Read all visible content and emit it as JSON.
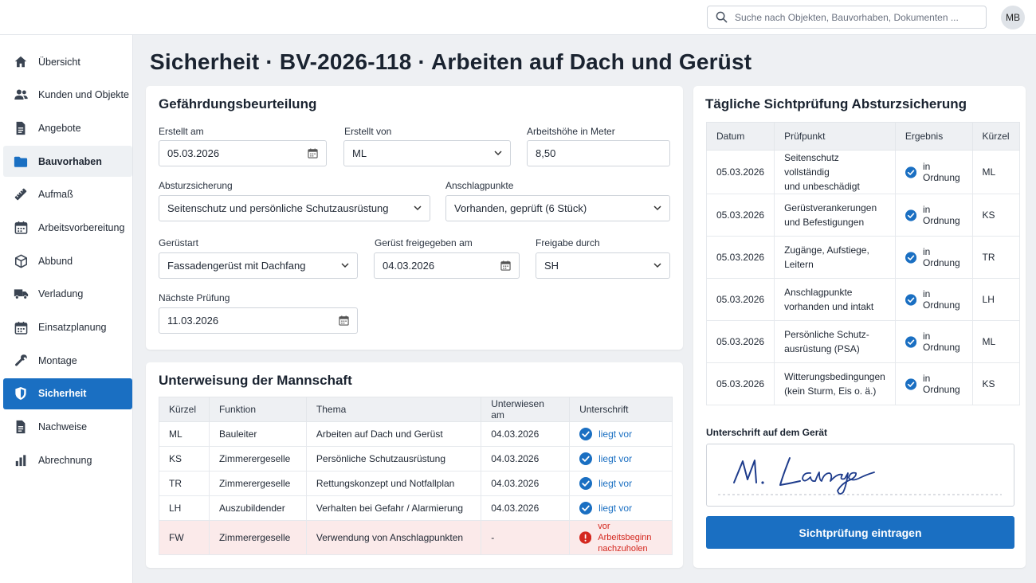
{
  "search": {
    "placeholder": "Suche nach Objekten, Bauvorhaben, Dokumenten ..."
  },
  "user": {
    "initials": "MB"
  },
  "sidebar": {
    "items": [
      {
        "label": "Übersicht",
        "icon": "home-icon"
      },
      {
        "label": "Kunden und Objekte",
        "icon": "people-icon"
      },
      {
        "label": "Angebote",
        "icon": "document-icon"
      },
      {
        "label": "Bauvorhaben",
        "icon": "folder-icon"
      },
      {
        "label": "Aufmaß",
        "icon": "ruler-icon"
      },
      {
        "label": "Arbeitsvorbereitung",
        "icon": "calendar-icon"
      },
      {
        "label": "Abbund",
        "icon": "cube-icon"
      },
      {
        "label": "Verladung",
        "icon": "truck-icon"
      },
      {
        "label": "Einsatzplanung",
        "icon": "calendar-icon"
      },
      {
        "label": "Montage",
        "icon": "wrench-icon"
      },
      {
        "label": "Sicherheit",
        "icon": "shield-icon"
      },
      {
        "label": "Nachweise",
        "icon": "document-icon"
      },
      {
        "label": "Abrechnung",
        "icon": "bar-chart-icon"
      }
    ]
  },
  "page": {
    "title": "Sicherheit · BV-2026-118 · Arbeiten auf Dach und Gerüst"
  },
  "risk": {
    "title": "Gefährdungsbeurteilung",
    "created_at": {
      "label": "Erstellt am",
      "value": "05.03.2026"
    },
    "created_by": {
      "label": "Erstellt von",
      "value": "ML"
    },
    "height": {
      "label": "Arbeitshöhe in Meter",
      "value": "8,50"
    },
    "fall_protection": {
      "label": "Absturzsicherung",
      "value": "Seitenschutz und persönliche Schutzausrüstung"
    },
    "anchor_points": {
      "label": "Anschlagpunkte",
      "value": "Vorhanden, geprüft (6 Stück)"
    },
    "scaffold_type": {
      "label": "Gerüstart",
      "value": "Fassadengerüst mit Dachfang"
    },
    "scaffold_released": {
      "label": "Gerüst freigegeben am",
      "value": "04.03.2026"
    },
    "released_by": {
      "label": "Freigabe durch",
      "value": "SH"
    },
    "next_check": {
      "label": "Nächste Prüfung",
      "value": "11.03.2026"
    }
  },
  "briefing": {
    "title": "Unterweisung der Mannschaft",
    "columns": [
      "Kürzel",
      "Funktion",
      "Thema",
      "Unterwiesen am",
      "Unterschrift"
    ],
    "rows": [
      {
        "code": "ML",
        "role": "Bauleiter",
        "topic": "Arbeiten auf Dach und Gerüst",
        "date": "04.03.2026",
        "sign": "liegt vor",
        "ok": true
      },
      {
        "code": "KS",
        "role": "Zimmerergeselle",
        "topic": "Persönliche Schutzausrüstung",
        "date": "04.03.2026",
        "sign": "liegt vor",
        "ok": true
      },
      {
        "code": "TR",
        "role": "Zimmerergeselle",
        "topic": "Rettungskonzept und Notfallplan",
        "date": "04.03.2026",
        "sign": "liegt vor",
        "ok": true
      },
      {
        "code": "LH",
        "role": "Auszubildender",
        "topic": "Verhalten bei Gefahr / Alarmierung",
        "date": "04.03.2026",
        "sign": "liegt vor",
        "ok": true
      },
      {
        "code": "FW",
        "role": "Zimmerergeselle",
        "topic": "Verwendung von Anschlagpunkten",
        "date": "-",
        "sign_line1": "vor Arbeitsbeginn",
        "sign_line2": "nachzuholen",
        "ok": false
      }
    ]
  },
  "inspection": {
    "title": "Tägliche Sichtprüfung Absturzsicherung",
    "columns": [
      "Datum",
      "Prüfpunkt",
      "Ergebnis",
      "Kürzel"
    ],
    "rows": [
      {
        "date": "05.03.2026",
        "item_line1": "Seitenschutz vollständig",
        "item_line2": "und unbeschädigt",
        "result": "in Ordnung",
        "code": "ML"
      },
      {
        "date": "05.03.2026",
        "item_line1": "Gerüstverankerungen",
        "item_line2": "und Befestigungen",
        "result": "in Ordnung",
        "code": "KS"
      },
      {
        "date": "05.03.2026",
        "item_line1": "Zugänge, Aufstiege,",
        "item_line2": "Leitern",
        "result": "in Ordnung",
        "code": "TR"
      },
      {
        "date": "05.03.2026",
        "item_line1": "Anschlagpunkte",
        "item_line2": "vorhanden und intakt",
        "result": "in Ordnung",
        "code": "LH"
      },
      {
        "date": "05.03.2026",
        "item_line1": "Persönliche Schutz-",
        "item_line2": "ausrüstung (PSA)",
        "result": "in Ordnung",
        "code": "ML"
      },
      {
        "date": "05.03.2026",
        "item_line1": "Witterungsbedingungen",
        "item_line2": "(kein Sturm, Eis o. ä.)",
        "result": "in Ordnung",
        "code": "KS"
      }
    ],
    "signature_label": "Unterschrift auf dem Gerät",
    "submit_label": "Sichtprüfung eintragen"
  },
  "colors": {
    "accent": "#1a6fc2",
    "error": "#d4281f",
    "warn_bg": "#fbeaea"
  }
}
